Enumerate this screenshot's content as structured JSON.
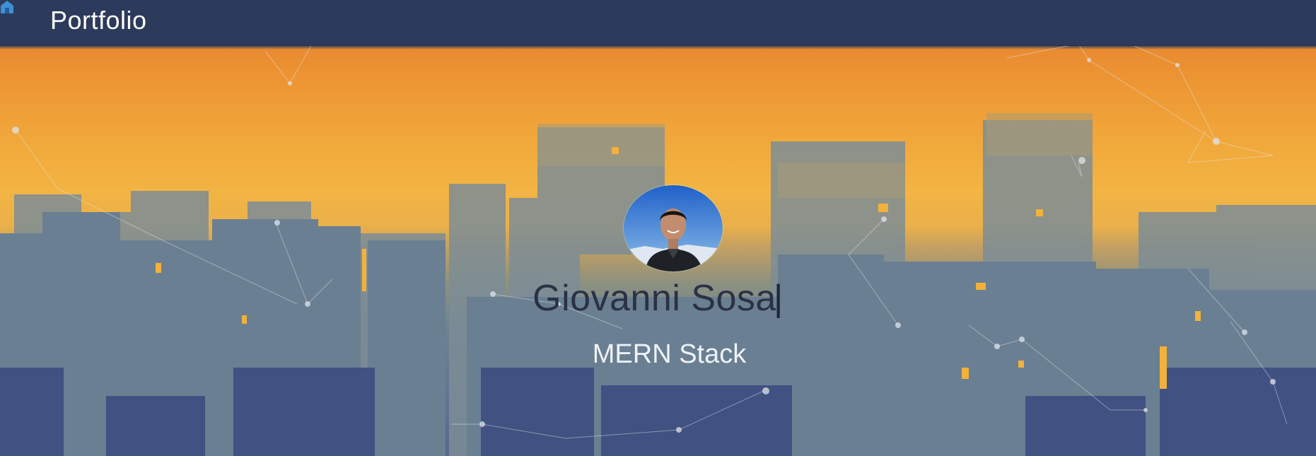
{
  "nav": {
    "brand": "Portfolio",
    "logo_icon": "home-icon"
  },
  "hero": {
    "name": "Giovanni Sosa",
    "caret": "|",
    "subtitle": "MERN Stack",
    "avatar": "profile-photo"
  },
  "colors": {
    "navbar": "#2c3a5b",
    "sky_top": "#e98b31",
    "sky_mid": "#f2b443",
    "city": "#5f7692",
    "name_text": "#2b3145",
    "subtitle_text": "#eef2f8"
  }
}
